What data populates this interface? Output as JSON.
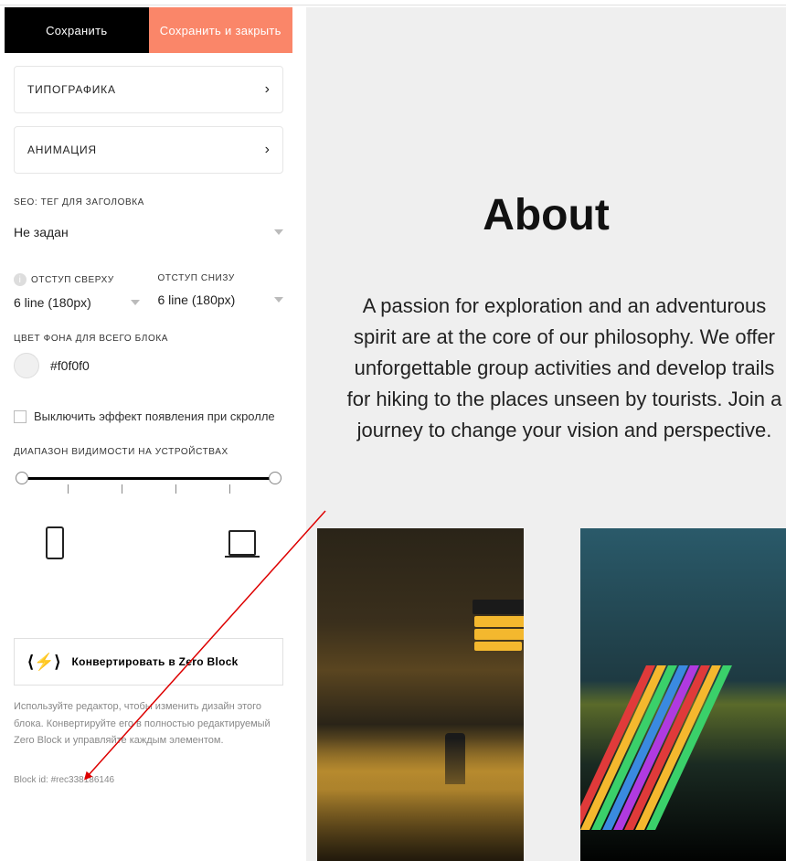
{
  "tabs": {
    "save": "Сохранить",
    "save_close": "Сохранить и закрыть"
  },
  "accordions": {
    "typography": "ТИПОГРАФИКА",
    "animation": "АНИМАЦИЯ"
  },
  "seo": {
    "label": "SEO: ТЕГ ДЛЯ ЗАГОЛОВКА",
    "value": "Не задан"
  },
  "padding": {
    "top_label": "ОТСТУП СВЕРХУ",
    "top_value": "6 line (180px)",
    "bottom_label": "ОТСТУП СНИЗУ",
    "bottom_value": "6 line (180px)"
  },
  "bg": {
    "label": "ЦВЕТ ФОНА ДЛЯ ВСЕГО БЛОКА",
    "hex": "#f0f0f0"
  },
  "scroll_effect": {
    "label": "Выключить эффект появления при скролле"
  },
  "visibility": {
    "label": "ДИАПАЗОН ВИДИМОСТИ НА УСТРОЙСТВАХ"
  },
  "convert": {
    "label": "Конвертировать в Zero Block"
  },
  "help": "Используйте редактор, чтобы изменить дизайн этого блока. Конвертируйте его в полностью редактируемый Zero Block и управляйте каждым элементом.",
  "block_id": "Block id: #rec338186146",
  "preview": {
    "title": "About",
    "text": "A passion for exploration and an adventurous spirit are at the core of our philosophy. We offer unforgettable group activities and develop trails for hiking to the places unseen by tourists. Join a journey to change your vision and perspective."
  },
  "colors": {
    "accent": "#fa8669",
    "dark": "#000000",
    "bg": "#efefef"
  }
}
